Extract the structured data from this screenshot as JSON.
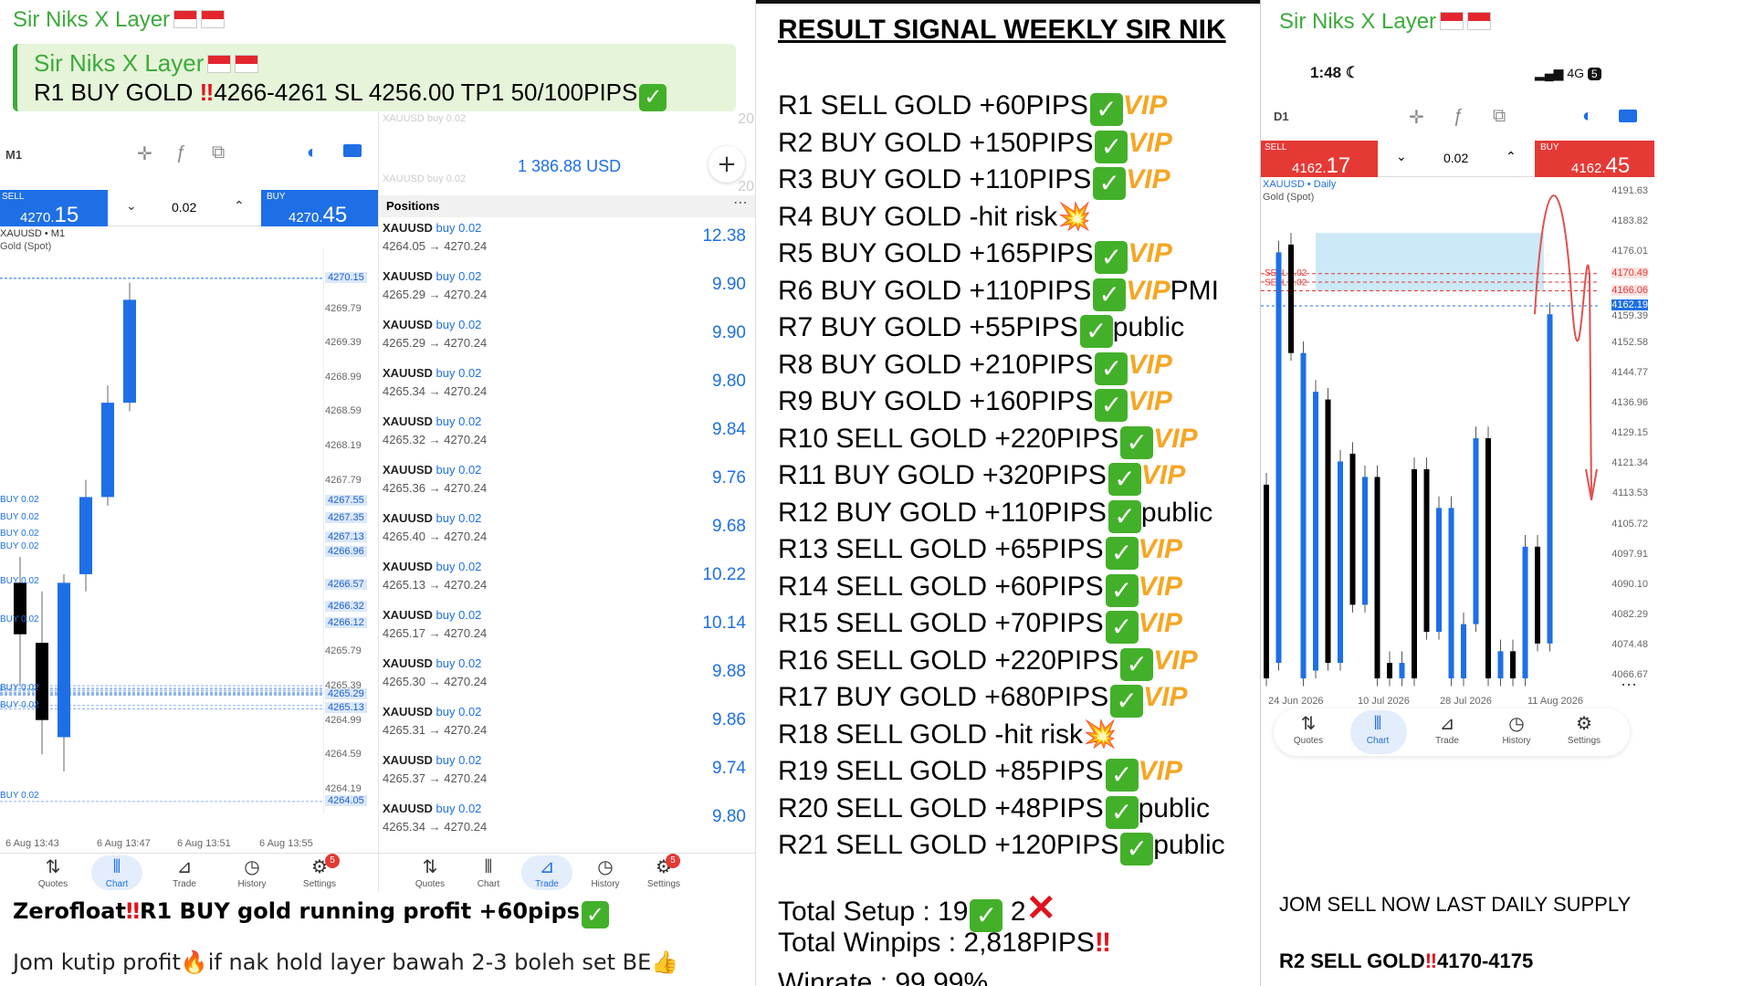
{
  "left": {
    "sender": "Sir Niks X Layer",
    "quote": {
      "name": "Sir Niks X Layer",
      "text_a": "R1 BUY GOLD",
      "text_b": "4266-4261  SL 4256.00  TP1 50/100PIPS"
    },
    "chart": {
      "timeframe": "M1",
      "sell_label": "SELL",
      "sell_main": "4270.",
      "sell_big": "15",
      "lot": "0.02",
      "buy_label": "BUY",
      "buy_main": "4270.",
      "buy_big": "45",
      "symbol": "XAUUSD • M1",
      "symbol_sub": "Gold (Spot)",
      "price_labels": [
        "4270.15",
        "4269.79",
        "4269.39",
        "4268.99",
        "4268.59",
        "4268.19",
        "4267.79",
        "4267.55",
        "4267.35",
        "4267.13",
        "4266.96",
        "4266.57",
        "4266.32",
        "4266.12",
        "4265.79",
        "4265.39",
        "4265.29",
        "4265.13",
        "4264.99",
        "4264.59",
        "4264.19",
        "4264.05"
      ],
      "line_labels": [
        "BUY 0.02",
        "BUY 0.02",
        "BUY 0.02",
        "BUY 0.02",
        "BUY 0.02",
        "BUY 0.02",
        "BUY 0.02",
        "BUY 0.02",
        "BUY 0.02"
      ],
      "dates": [
        "6 Aug 13:43",
        "6 Aug 13:47",
        "6 Aug 13:51",
        "6 Aug 13:55"
      ],
      "nav": [
        "Quotes",
        "Chart",
        "Trade",
        "History",
        "Settings"
      ],
      "badge": "5",
      "candles": [
        {
          "o": 4266.6,
          "c": 4266.0,
          "h": 4266.9,
          "l": 4265.4
        },
        {
          "o": 4265.9,
          "c": 4265.0,
          "h": 4266.5,
          "l": 4264.6
        },
        {
          "o": 4264.8,
          "c": 4266.6,
          "h": 4266.7,
          "l": 4264.4
        },
        {
          "o": 4266.7,
          "c": 4267.6,
          "h": 4267.8,
          "l": 4266.5
        },
        {
          "o": 4267.6,
          "c": 4268.7,
          "h": 4268.9,
          "l": 4267.5
        },
        {
          "o": 4268.7,
          "c": 4269.9,
          "h": 4270.1,
          "l": 4268.6
        }
      ]
    },
    "trade": {
      "balance": "1 386.88 USD",
      "header": "Positions",
      "hidden_top": "XAUUSD buy 0.02",
      "partial_profit_a": "20",
      "partial_profit_b": "20",
      "positions": [
        {
          "sym": "XAUUSD",
          "dir": "buy 0.02",
          "prices": "4264.05 → 4270.24",
          "pl": "12.38"
        },
        {
          "sym": "XAUUSD",
          "dir": "buy 0.02",
          "prices": "4265.29 → 4270.24",
          "pl": "9.90"
        },
        {
          "sym": "XAUUSD",
          "dir": "buy 0.02",
          "prices": "4265.29 → 4270.24",
          "pl": "9.90"
        },
        {
          "sym": "XAUUSD",
          "dir": "buy 0.02",
          "prices": "4265.34 → 4270.24",
          "pl": "9.80"
        },
        {
          "sym": "XAUUSD",
          "dir": "buy 0.02",
          "prices": "4265.32 → 4270.24",
          "pl": "9.84"
        },
        {
          "sym": "XAUUSD",
          "dir": "buy 0.02",
          "prices": "4265.36 → 4270.24",
          "pl": "9.76"
        },
        {
          "sym": "XAUUSD",
          "dir": "buy 0.02",
          "prices": "4265.40 → 4270.24",
          "pl": "9.68"
        },
        {
          "sym": "XAUUSD",
          "dir": "buy 0.02",
          "prices": "4265.13 → 4270.24",
          "pl": "10.22"
        },
        {
          "sym": "XAUUSD",
          "dir": "buy 0.02",
          "prices": "4265.17 → 4270.24",
          "pl": "10.14"
        },
        {
          "sym": "XAUUSD",
          "dir": "buy 0.02",
          "prices": "4265.30 → 4270.24",
          "pl": "9.88"
        },
        {
          "sym": "XAUUSD",
          "dir": "buy 0.02",
          "prices": "4265.31 → 4270.24",
          "pl": "9.86"
        },
        {
          "sym": "XAUUSD",
          "dir": "buy 0.02",
          "prices": "4265.37 → 4270.24",
          "pl": "9.74"
        },
        {
          "sym": "XAUUSD",
          "dir": "buy 0.02",
          "prices": "4265.34 → 4270.24",
          "pl": "9.80"
        }
      ],
      "nav": [
        "Quotes",
        "Chart",
        "Trade",
        "History",
        "Settings"
      ],
      "badge": "5"
    },
    "msg1_a": "Zerofloat",
    "msg1_b": "R1 BUY gold running profit +60pips",
    "msg2_a": "Jom kutip profit",
    "msg2_b": "if nak hold layer bawah 2-3 boleh set BE"
  },
  "result": {
    "title": "RESULT SIGNAL WEEKLY SIR NIK",
    "rows": [
      {
        "text": "R1 SELL GOLD +60PIPS",
        "mark": "check",
        "tag": "VIP"
      },
      {
        "text": "R2 BUY GOLD +150PIPS",
        "mark": "check",
        "tag": "VIP"
      },
      {
        "text": "R3 BUY GOLD +110PIPS",
        "mark": "check",
        "tag": "VIP"
      },
      {
        "text": "R4 BUY GOLD -hit risk",
        "mark": "boom",
        "tag": ""
      },
      {
        "text": "R5 BUY GOLD +165PIPS",
        "mark": "check",
        "tag": "VIP"
      },
      {
        "text": "R6 BUY GOLD +110PIPS",
        "mark": "check",
        "tag": "VIP",
        "extra": "PMI"
      },
      {
        "text": "R7 BUY GOLD +55PIPS",
        "mark": "check",
        "tag": "",
        "extra": "public"
      },
      {
        "text": "R8 BUY GOLD +210PIPS",
        "mark": "check",
        "tag": "VIP"
      },
      {
        "text": "R9 BUY GOLD +160PIPS",
        "mark": "check",
        "tag": "VIP"
      },
      {
        "text": "R10 SELL GOLD +220PIPS",
        "mark": "check",
        "tag": "VIP"
      },
      {
        "text": "R11 BUY GOLD +320PIPS",
        "mark": "check",
        "tag": "VIP"
      },
      {
        "text": "R12 BUY GOLD +110PIPS",
        "mark": "check",
        "tag": "",
        "extra": "public"
      },
      {
        "text": "R13 SELL GOLD +65PIPS",
        "mark": "check",
        "tag": "VIP"
      },
      {
        "text": "R14 SELL GOLD +60PIPS",
        "mark": "check",
        "tag": "VIP"
      },
      {
        "text": "R15 SELL GOLD +70PIPS",
        "mark": "check",
        "tag": "VIP"
      },
      {
        "text": "R16 SELL GOLD +220PIPS",
        "mark": "check",
        "tag": "VIP"
      },
      {
        "text": "R17 BUY GOLD +680PIPS",
        "mark": "check",
        "tag": "VIP"
      },
      {
        "text": "R18 SELL GOLD -hit risk",
        "mark": "boom",
        "tag": ""
      },
      {
        "text": "R19 SELL GOLD +85PIPS",
        "mark": "check",
        "tag": "VIP"
      },
      {
        "text": "R20 SELL GOLD +48PIPS",
        "mark": "check",
        "tag": "",
        "extra": "public"
      },
      {
        "text": "R21 SELL GOLD +120PIPS",
        "mark": "check",
        "tag": "",
        "extra": "public"
      }
    ],
    "total_setup_a": "Total Setup : 19",
    "total_setup_b": "2",
    "total_winpips": "Total Winpips : 2,818PIPS",
    "winrate": "Winrate : 99.99%"
  },
  "right": {
    "sender": "Sir Niks X Layer",
    "time": "1:48",
    "network": "4G",
    "battery": "5",
    "timeframe": "D1",
    "sell_label": "SELL",
    "sell_main": "4162.",
    "sell_big": "17",
    "lot": "0.02",
    "buy_label": "BUY",
    "buy_main": "4162.",
    "buy_big": "45",
    "symbol": "XAUUSD • Daily",
    "symbol_sub": "Gold (Spot)",
    "axis": [
      "4191.63",
      "4183.82",
      "4176.01",
      "4170.49",
      "4166.06",
      "4162.19",
      "4159.39",
      "4152.58",
      "4144.77",
      "4136.96",
      "4129.15",
      "4121.34",
      "4113.53",
      "4105.72",
      "4097.91",
      "4090.10",
      "4082.29",
      "4074.48",
      "4066.67"
    ],
    "sell_lines": [
      "SELL 0.02",
      "SELL 0.02"
    ],
    "dates": [
      "24 Jun 2026",
      "10 Jul 2026",
      "28 Jul 2026",
      "11 Aug 2026"
    ],
    "nav": [
      "Quotes",
      "Chart",
      "Trade",
      "History",
      "Settings"
    ],
    "msg1": "JOM SELL NOW LAST DAILY SUPPLY",
    "msg2_a": "R2 SELL GOLD",
    "msg2_b": "4170-4175"
  },
  "colors": {
    "accent": "#1e6fe6",
    "sell_red": "#e53935",
    "telegram_green": "#3bab3b",
    "check_green": "#43b02a",
    "vip_gold": "#f5a623"
  }
}
